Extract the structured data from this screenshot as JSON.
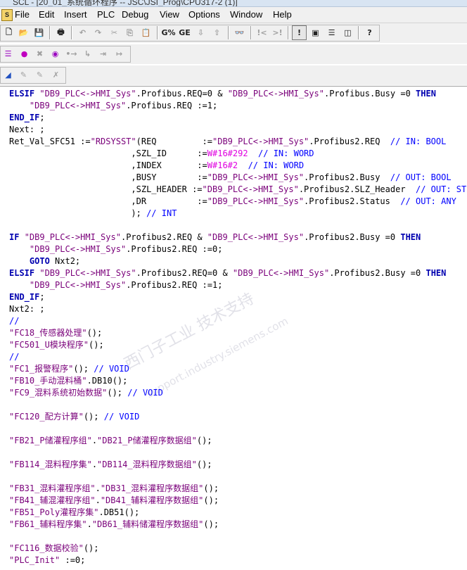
{
  "window": {
    "title": "SCL - [20_01_系统循环程序 -- JSC\\JSI_Prog\\CPU317-2 (1)]"
  },
  "menu": [
    "File",
    "Edit",
    "Insert",
    "PLC",
    "Debug",
    "View",
    "Options",
    "Window",
    "Help"
  ],
  "toolbar1": {
    "buttons": [
      {
        "name": "new-icon",
        "glyph": "🗋"
      },
      {
        "name": "open-icon",
        "glyph": "📂"
      },
      {
        "name": "save-icon",
        "glyph": "💾"
      },
      {
        "name": "print-icon",
        "glyph": "🖶"
      },
      {
        "name": "undo-icon",
        "glyph": "↶"
      },
      {
        "name": "redo-icon",
        "glyph": "↷"
      },
      {
        "name": "cut-icon",
        "glyph": "✂"
      },
      {
        "name": "copy-icon",
        "glyph": "⎘"
      },
      {
        "name": "paste-icon",
        "glyph": "📋"
      },
      {
        "name": "compile-icon",
        "glyph": "G%"
      },
      {
        "name": "compile-all-icon",
        "glyph": "GE"
      },
      {
        "name": "download-icon",
        "glyph": "⇩"
      },
      {
        "name": "upload-icon",
        "glyph": "⇧"
      },
      {
        "name": "find-icon",
        "glyph": "👓"
      },
      {
        "name": "prev-error-icon",
        "glyph": "!<"
      },
      {
        "name": "next-error-icon",
        "glyph": ">!"
      },
      {
        "name": "error-info-icon",
        "glyph": "!"
      },
      {
        "name": "cascade-icon",
        "glyph": "▣"
      },
      {
        "name": "tile-horizontal-icon",
        "glyph": "☰"
      },
      {
        "name": "tile-vertical-icon",
        "glyph": "◫"
      },
      {
        "name": "help-icon",
        "glyph": "?"
      }
    ]
  },
  "toolbar2": {
    "buttons": [
      {
        "name": "list-icon",
        "glyph": "☰"
      },
      {
        "name": "breakpoint-icon",
        "glyph": "●"
      },
      {
        "name": "delete-breakpoint-icon",
        "glyph": "✖"
      },
      {
        "name": "monitor-icon",
        "glyph": "◉"
      },
      {
        "name": "step-icon",
        "glyph": "•→"
      },
      {
        "name": "step-into-icon",
        "glyph": "↳"
      },
      {
        "name": "step-out-icon",
        "glyph": "⇥"
      },
      {
        "name": "run-to-cursor-icon",
        "glyph": "↦"
      }
    ]
  },
  "toolbar3": {
    "buttons": [
      {
        "name": "highlight-icon",
        "glyph": "◢"
      },
      {
        "name": "monitor-on-icon",
        "glyph": "✎"
      },
      {
        "name": "monitor-off-icon",
        "glyph": "✎"
      },
      {
        "name": "clear-monitor-icon",
        "glyph": "✗"
      }
    ]
  },
  "code": [
    {
      "t": [
        [
          "kw",
          "ELSIF "
        ],
        [
          "str",
          "\"DB9_PLC<->HMI_Sys\""
        ],
        [
          "",
          "."
        ],
        [
          "",
          "Profibus.REQ"
        ],
        [
          "",
          ""
        ],
        [
          "",
          "=0 & "
        ],
        [
          "str",
          "\"DB9_PLC<->HMI_Sys\""
        ],
        [
          "",
          ".Profibus.Busy =0 "
        ],
        [
          "kw",
          "THEN"
        ]
      ]
    },
    {
      "t": [
        [
          "",
          "    "
        ],
        [
          "str",
          "\"DB9_PLC<->HMI_Sys\""
        ],
        [
          "",
          ".Profibus.REQ :="
        ],
        [
          "",
          "1;"
        ]
      ]
    },
    {
      "t": [
        [
          "kw",
          "END_IF"
        ],
        [
          "",
          ";"
        ]
      ]
    },
    {
      "t": [
        [
          "",
          "Next: ;"
        ]
      ]
    },
    {
      "t": [
        [
          "",
          "Ret_Val_SFC51 :="
        ],
        [
          "str",
          "\"RDSYSST\""
        ],
        [
          "",
          "(REQ         :="
        ],
        [
          "str",
          "\"DB9_PLC<->HMI_Sys\""
        ],
        [
          "",
          ".Profibus2.REQ  "
        ],
        [
          "cmt",
          "// IN: BOOL"
        ]
      ]
    },
    {
      "t": [
        [
          "",
          "                        ,SZL_ID      :="
        ],
        [
          "num",
          "W#16#292"
        ],
        [
          "",
          "  "
        ],
        [
          "cmt",
          "// IN: WORD"
        ]
      ]
    },
    {
      "t": [
        [
          "",
          "                        ,INDEX       :="
        ],
        [
          "num",
          "W#16#2"
        ],
        [
          "",
          "  "
        ],
        [
          "cmt",
          "// IN: WORD"
        ]
      ]
    },
    {
      "t": [
        [
          "",
          "                        ,BUSY        :="
        ],
        [
          "str",
          "\"DB9_PLC<->HMI_Sys\""
        ],
        [
          "",
          ".Profibus2.Busy  "
        ],
        [
          "cmt",
          "// OUT: BOOL"
        ]
      ]
    },
    {
      "t": [
        [
          "",
          "                        ,SZL_HEADER :="
        ],
        [
          "str",
          "\"DB9_PLC<->HMI_Sys\""
        ],
        [
          "",
          ".Profibus2.SLZ_Header  "
        ],
        [
          "cmt",
          "// OUT: STRUCT"
        ]
      ]
    },
    {
      "t": [
        [
          "",
          "                        ,DR          :="
        ],
        [
          "str",
          "\"DB9_PLC<->HMI_Sys\""
        ],
        [
          "",
          ".Profibus2.Status  "
        ],
        [
          "cmt",
          "// OUT: ANY"
        ]
      ]
    },
    {
      "t": [
        [
          "",
          "                        ); "
        ],
        [
          "cmt",
          "// INT"
        ]
      ]
    },
    {
      "t": [
        [
          "",
          ""
        ]
      ]
    },
    {
      "t": [
        [
          "kw",
          "IF "
        ],
        [
          "str",
          "\"DB9_PLC<->HMI_Sys\""
        ],
        [
          "",
          ".Profibus2.REQ & "
        ],
        [
          "str",
          "\"DB9_PLC<->HMI_Sys\""
        ],
        [
          "",
          ".Profibus2.Busy =0 "
        ],
        [
          "kw",
          "THEN"
        ]
      ]
    },
    {
      "t": [
        [
          "",
          "    "
        ],
        [
          "str",
          "\"DB9_PLC<->HMI_Sys\""
        ],
        [
          "",
          ".Profibus2.REQ :=0;"
        ]
      ]
    },
    {
      "t": [
        [
          "",
          "    "
        ],
        [
          "kw",
          "GOTO"
        ],
        [
          "",
          " Nxt2;"
        ]
      ]
    },
    {
      "t": [
        [
          "kw",
          "ELSIF "
        ],
        [
          "str",
          "\"DB9_PLC<->HMI_Sys\""
        ],
        [
          "",
          ".Profibus2.REQ=0 & "
        ],
        [
          "str",
          "\"DB9_PLC<->HMI_Sys\""
        ],
        [
          "",
          ".Profibus2.Busy =0 "
        ],
        [
          "kw",
          "THEN"
        ]
      ]
    },
    {
      "t": [
        [
          "",
          "    "
        ],
        [
          "str",
          "\"DB9_PLC<->HMI_Sys\""
        ],
        [
          "",
          ".Profibus2.REQ :=1;"
        ]
      ]
    },
    {
      "t": [
        [
          "kw",
          "END_IF"
        ],
        [
          "",
          ";"
        ]
      ]
    },
    {
      "t": [
        [
          "",
          "Nxt2: ;"
        ]
      ]
    },
    {
      "t": [
        [
          "cmt",
          "//"
        ]
      ]
    },
    {
      "t": [
        [
          "str",
          "\"FC18_传感器处理\""
        ],
        [
          "",
          "();"
        ]
      ]
    },
    {
      "t": [
        [
          "str",
          "\"FC501_U模块程序\""
        ],
        [
          "",
          "();"
        ]
      ]
    },
    {
      "t": [
        [
          "cmt",
          "//"
        ]
      ]
    },
    {
      "t": [
        [
          "str",
          "\"FC1_报警程序\""
        ],
        [
          "",
          "(); "
        ],
        [
          "cmt",
          "// VOID"
        ]
      ]
    },
    {
      "t": [
        [
          "str",
          "\"FB10_手动混料桶\""
        ],
        [
          "",
          ".DB10();"
        ]
      ]
    },
    {
      "t": [
        [
          "str",
          "\"FC9_混料系统初始数据\""
        ],
        [
          "",
          "(); "
        ],
        [
          "cmt",
          "// VOID"
        ]
      ]
    },
    {
      "t": [
        [
          "",
          ""
        ]
      ]
    },
    {
      "t": [
        [
          "str",
          "\"FC120_配方计算\""
        ],
        [
          "",
          "(); "
        ],
        [
          "cmt",
          "// VOID"
        ]
      ]
    },
    {
      "t": [
        [
          "",
          ""
        ]
      ]
    },
    {
      "t": [
        [
          "str",
          "\"FB21_P储灌程序组\""
        ],
        [
          "",
          "."
        ],
        [
          "str",
          "\"DB21_P储灌程序数据组\""
        ],
        [
          "",
          "();"
        ]
      ]
    },
    {
      "t": [
        [
          "",
          ""
        ]
      ]
    },
    {
      "t": [
        [
          "str",
          "\"FB114_混料程序集\""
        ],
        [
          "",
          "."
        ],
        [
          "str",
          "\"DB114_混料程序数据组\""
        ],
        [
          "",
          "();"
        ]
      ]
    },
    {
      "t": [
        [
          "",
          ""
        ]
      ]
    },
    {
      "t": [
        [
          "str",
          "\"FB31_混料灌程序组\""
        ],
        [
          "",
          "."
        ],
        [
          "str",
          "\"DB31_混料灌程序数据组\""
        ],
        [
          "",
          "();"
        ]
      ]
    },
    {
      "t": [
        [
          "str",
          "\"FB41_辅混灌程序组\""
        ],
        [
          "",
          "."
        ],
        [
          "str",
          "\"DB41_辅料灌程序数据组\""
        ],
        [
          "",
          "();"
        ]
      ]
    },
    {
      "t": [
        [
          "str",
          "\"FB51_Poly灌程序集\""
        ],
        [
          "",
          ".DB51();"
        ]
      ]
    },
    {
      "t": [
        [
          "str",
          "\"FB61_辅料程序集\""
        ],
        [
          "",
          "."
        ],
        [
          "str",
          "\"DB61_辅料储灌程序数据组\""
        ],
        [
          "",
          "();"
        ]
      ]
    },
    {
      "t": [
        [
          "",
          ""
        ]
      ]
    },
    {
      "t": [
        [
          "str",
          "\"FC116_数据校验\""
        ],
        [
          "",
          "();"
        ]
      ]
    },
    {
      "t": [
        [
          "str",
          "\"PLC_Init\""
        ],
        [
          "",
          " :=0;"
        ]
      ]
    }
  ],
  "watermark": {
    "line1": "西门子工业 技术支持",
    "line2": "support.industry.siemens.com"
  }
}
